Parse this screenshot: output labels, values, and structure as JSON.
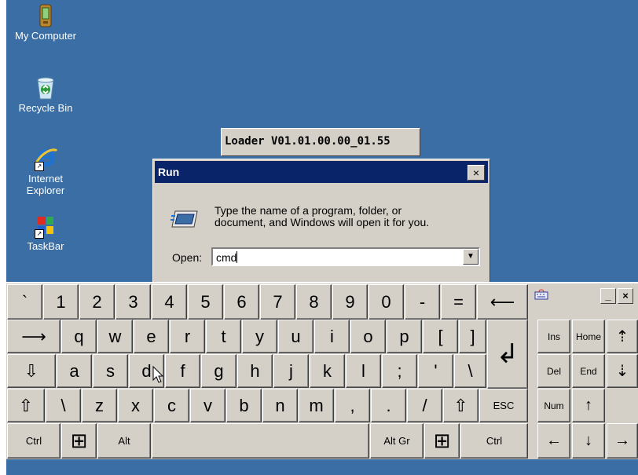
{
  "desktop": {
    "icons": [
      {
        "label": "My Computer",
        "icon": "pda-icon"
      },
      {
        "label": "Recycle Bin",
        "icon": "recycle-bin-icon"
      },
      {
        "label": "Internet Explorer",
        "icon": "internet-explorer-icon"
      },
      {
        "label": "TaskBar",
        "icon": "taskbar-icon"
      }
    ]
  },
  "loader": {
    "title": "Loader V01.01.00.00_01.55"
  },
  "run_dialog": {
    "title": "Run",
    "close_label": "×",
    "message_line1": "Type the name of a program, folder, or",
    "message_line2": "document, and Windows will open it for you.",
    "open_label": "Open:",
    "open_value": "cmd",
    "dropdown_glyph": "▼"
  },
  "keyboard": {
    "row1": [
      "`",
      "1",
      "2",
      "3",
      "4",
      "5",
      "6",
      "7",
      "8",
      "9",
      "0",
      "-",
      "=",
      "⟵"
    ],
    "row2": [
      "⟶",
      "q",
      "w",
      "e",
      "r",
      "t",
      "y",
      "u",
      "i",
      "o",
      "p",
      "[",
      "]"
    ],
    "row3": [
      "⇩",
      "a",
      "s",
      "d",
      "f",
      "g",
      "h",
      "j",
      "k",
      "l",
      ";",
      "'",
      "\\"
    ],
    "row4": [
      "⇧",
      "\\",
      "z",
      "x",
      "c",
      "v",
      "b",
      "n",
      "m",
      ",",
      ".",
      "/",
      "⇧",
      "ESC"
    ],
    "row5": [
      "Ctrl",
      "Alt",
      "Alt Gr",
      "Ctrl"
    ],
    "enter_glyph": "↲",
    "win_glyph": "⊞"
  },
  "nav": {
    "minimize": "_",
    "close": "×",
    "ins": "Ins",
    "home": "Home",
    "pgup": "⇡",
    "del": "Del",
    "end": "End",
    "pgdn": "⇣",
    "num": "Num",
    "up": "↑",
    "left": "←",
    "down": "↓",
    "right": "→"
  },
  "colors": {
    "desktop": "#3a6ea5",
    "titlebar": "#0a246a",
    "face": "#d4d0c8"
  }
}
